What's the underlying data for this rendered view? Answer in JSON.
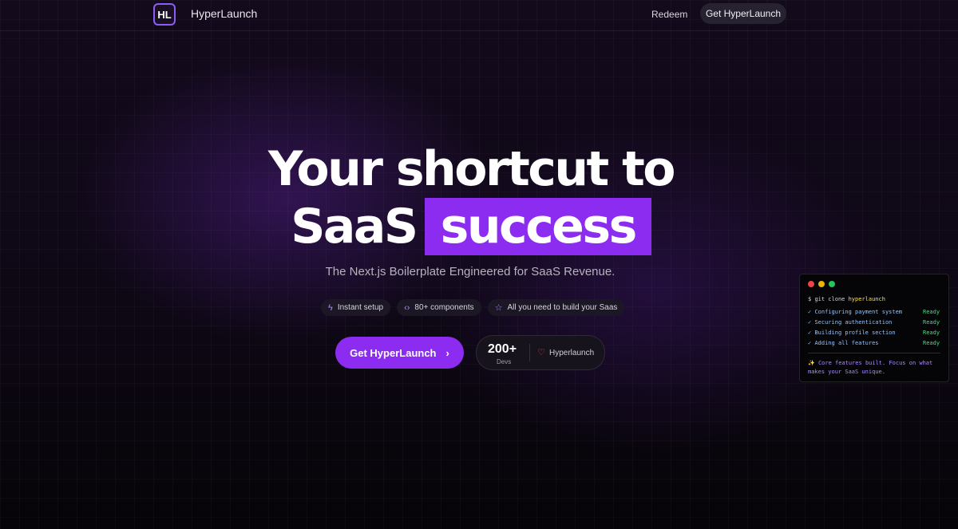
{
  "header": {
    "logo_text": "HL",
    "brand": "HyperLaunch",
    "nav_link": "Redeem",
    "nav_button": "Get HyperLaunch"
  },
  "hero": {
    "line1": "Your shortcut to",
    "line2_plain": "SaaS",
    "line2_highlight": "success",
    "subtitle": "The Next.js Boilerplate Engineered for SaaS Revenue.",
    "chips": [
      {
        "icon": "lightning-icon",
        "label": "Instant setup"
      },
      {
        "icon": "code-icon",
        "label": "80+ components"
      },
      {
        "icon": "star-icon",
        "label": "All you need to build your Saas"
      }
    ],
    "cta_label": "Get HyperLaunch",
    "social_count": "200+",
    "social_unit": "Devs",
    "social_name": "Hyperlaunch"
  },
  "terminal": {
    "prompt": "$",
    "command": "git clone",
    "command_arg": "hyperlaunch",
    "steps": [
      {
        "label": "Configuring payment system",
        "status": "Ready"
      },
      {
        "label": "Securing authentication",
        "status": "Ready"
      },
      {
        "label": "Building profile section",
        "status": "Ready"
      },
      {
        "label": "Adding all features",
        "status": "Ready"
      }
    ],
    "message": "Core features built. Focus on what makes your SaaS unique."
  },
  "colors": {
    "accent": "#8b2cf0",
    "background": "#0a060e",
    "terminal_ok": "#4ade80",
    "terminal_step": "#93c5fd"
  }
}
